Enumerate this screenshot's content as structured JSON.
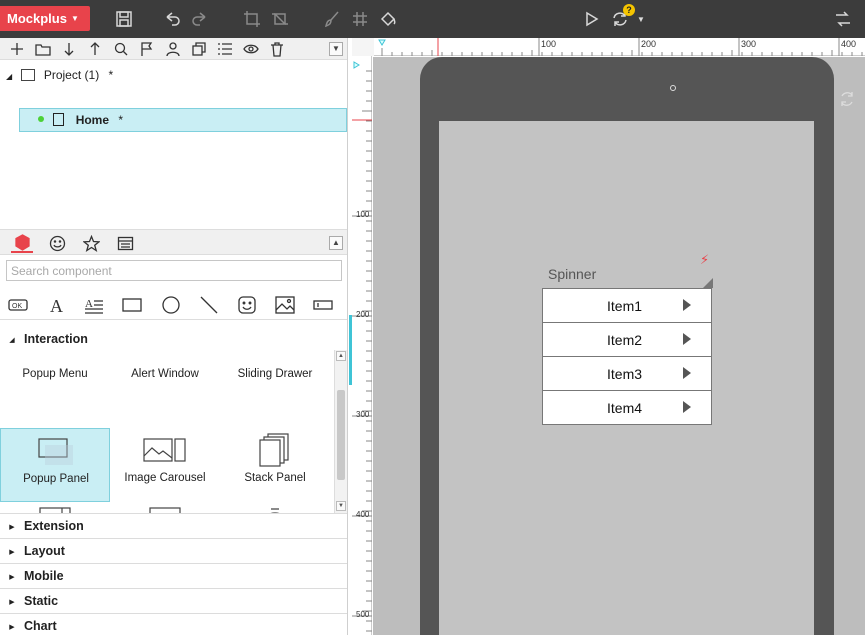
{
  "app": {
    "logo_text": "Mockplus",
    "accent_color": "#e8434b",
    "selection_color": "#c9eef4"
  },
  "toolbar": {
    "icons": [
      "save-icon",
      "undo-icon",
      "redo-icon",
      "crop-icon",
      "crop-alt-icon",
      "brush-icon",
      "grid-icon",
      "paint-bucket-icon",
      "play-icon",
      "sync-icon",
      "exit-icon"
    ],
    "sync_badge": "?"
  },
  "project_toolbar": {
    "icons": [
      "add-icon",
      "folder-icon",
      "arrow-down-icon",
      "arrow-up-icon",
      "search-icon",
      "flag-icon",
      "user-icon",
      "copy-icon",
      "list-icon",
      "eye-icon",
      "trash-icon"
    ]
  },
  "tree": {
    "project_label": "Project (1)",
    "project_star": "*",
    "home_label": "Home",
    "home_star": "*"
  },
  "component_tabs": [
    "component-icon",
    "emoji-icon",
    "star-icon",
    "layout-icon"
  ],
  "search": {
    "placeholder": "Search component"
  },
  "basic_components": [
    "button-ok-icon",
    "text-icon",
    "paragraph-icon",
    "rectangle-icon",
    "circle-icon",
    "line-icon",
    "emoji-icon",
    "image-icon",
    "input-icon"
  ],
  "interaction": {
    "header": "Interaction",
    "items": [
      {
        "label": "Popup Menu"
      },
      {
        "label": "Alert Window"
      },
      {
        "label": "Sliding Drawer"
      },
      {
        "label": "Popup Panel"
      },
      {
        "label": "Image Carousel"
      },
      {
        "label": "Stack Panel"
      }
    ]
  },
  "categories": [
    "Extension",
    "Layout",
    "Mobile",
    "Static",
    "Chart"
  ],
  "ruler": {
    "top_labels": [
      "100",
      "200",
      "300",
      "400"
    ],
    "left_labels": [
      "100",
      "200",
      "300",
      "400",
      "500"
    ]
  },
  "spinner": {
    "label": "Spinner",
    "items": [
      "Item1",
      "Item2",
      "Item3",
      "Item4"
    ]
  }
}
